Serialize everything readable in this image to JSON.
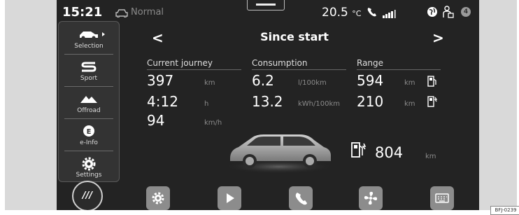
{
  "status": {
    "time": "15:21",
    "drive_mode": "Normal",
    "temperature": "20.5",
    "temperature_unit": "°C",
    "notification_count": "4"
  },
  "menu": {
    "items": [
      {
        "label": "Selection",
        "icon": "car-icon"
      },
      {
        "label": "Sport",
        "icon": "sport-s-icon"
      },
      {
        "label": "Offroad",
        "icon": "mountain-icon"
      },
      {
        "label": "e-Info",
        "icon": "e-circle-icon"
      },
      {
        "label": "Settings",
        "icon": "gear-icon"
      }
    ]
  },
  "header": {
    "prev": "<",
    "title": "Since start",
    "next": ">"
  },
  "journey": {
    "heading": "Current journey",
    "distance": "397",
    "distance_unit": "km",
    "duration": "4:12",
    "duration_unit": "h",
    "speed": "94",
    "speed_unit": "km/h"
  },
  "consumption": {
    "heading": "Consumption",
    "fuel": "6.2",
    "fuel_unit": "l/100km",
    "electric": "13.2",
    "electric_unit": "kWh/100km"
  },
  "range": {
    "heading": "Range",
    "fuel": "594",
    "fuel_unit": "km",
    "electric": "210",
    "electric_unit": "km",
    "total": "804",
    "total_unit": "km"
  },
  "dock": {
    "main_label": "///",
    "buttons": [
      "gear-icon",
      "play-icon",
      "phone-icon",
      "fan-icon",
      "keyboard-icon"
    ]
  },
  "reference": "BFJ-0239"
}
